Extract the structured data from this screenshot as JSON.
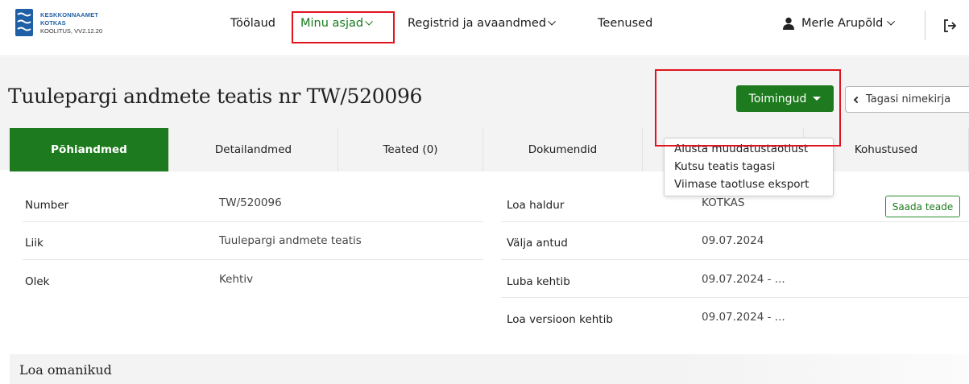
{
  "header": {
    "logo": {
      "org": "KESKKONNAAMET",
      "app": "KOTKAS",
      "version": "KOOLITUS, VV2.12.20"
    },
    "nav": [
      {
        "label": "Töölaud"
      },
      {
        "label": "Minu asjad"
      },
      {
        "label": "Registrid ja avaandmed"
      },
      {
        "label": "Teenused"
      }
    ],
    "user": {
      "name": "Merle Arupõld"
    }
  },
  "page": {
    "title": "Tuulepargi andmete teatis nr TW/520096",
    "actions_button": "Toimingud",
    "back_button": "Tagasi nimekirja"
  },
  "tabs": [
    {
      "label": "Põhiandmed"
    },
    {
      "label": "Detailandmed"
    },
    {
      "label": "Teated (0)"
    },
    {
      "label": "Dokumendid"
    },
    {
      "label": ""
    },
    {
      "label": "Kohustused"
    }
  ],
  "actions_menu": [
    {
      "label": "Alusta muudatustaotlust"
    },
    {
      "label": "Kutsu teatis tagasi"
    },
    {
      "label": "Viimase taotluse eksport"
    }
  ],
  "details_left": [
    {
      "label": "Number",
      "value": "TW/520096"
    },
    {
      "label": "Liik",
      "value": "Tuulepargi andmete teatis"
    },
    {
      "label": "Olek",
      "value": "Kehtiv"
    }
  ],
  "details_right": [
    {
      "label": "Loa haldur",
      "value": "KOTKAS"
    },
    {
      "label": "Välja antud",
      "value": "09.07.2024"
    },
    {
      "label": "Luba kehtib",
      "value": "09.07.2024 - ..."
    },
    {
      "label": "Loa versioon kehtib",
      "value": "09.07.2024 - ..."
    }
  ],
  "send_message_button": "Saada teade",
  "owners_section": {
    "title": "Loa omanikud"
  },
  "colors": {
    "primary": "#1e7a1e",
    "highlight": "#e0141e",
    "logo_blue": "#1f5fa5"
  }
}
